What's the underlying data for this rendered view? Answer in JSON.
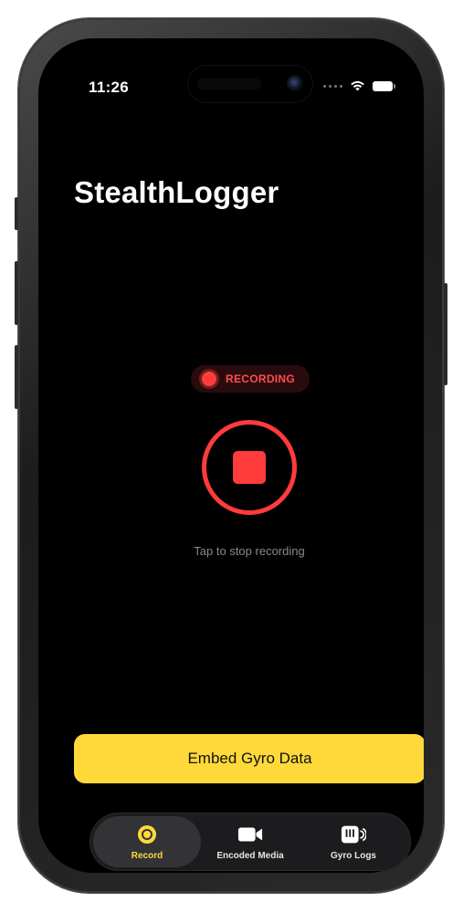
{
  "status_bar": {
    "time": "11:26"
  },
  "app": {
    "title": "StealthLogger"
  },
  "recording": {
    "badge_label": "RECORDING",
    "hint": "Tap to stop recording",
    "accent_color": "#ff3b3b"
  },
  "actions": {
    "embed_label": "Embed Gyro Data",
    "embed_color": "#ffd93a"
  },
  "tabs": [
    {
      "label": "Record",
      "icon": "record-icon",
      "active": true
    },
    {
      "label": "Encoded Media",
      "icon": "video-camera-icon",
      "active": false
    },
    {
      "label": "Gyro Logs",
      "icon": "gyro-log-icon",
      "active": false
    }
  ]
}
